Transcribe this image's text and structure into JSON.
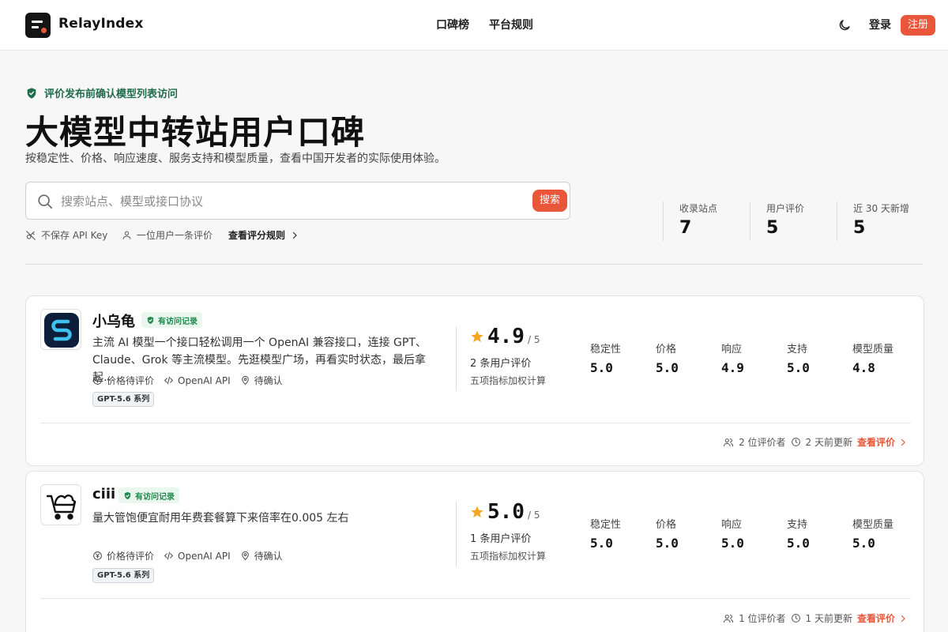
{
  "header": {
    "brand": "RelayIndex",
    "nav": [
      "口碑榜",
      "平台规则"
    ],
    "login": "登录",
    "register": "注册"
  },
  "hero": {
    "notice": "评价发布前确认模型列表访问",
    "title": "大模型中转站用户口碑",
    "subtitle": "按稳定性、价格、响应速度、服务支持和模型质量，查看中国开发者的实际使用体验。",
    "search": {
      "placeholder": "搜索站点、模型或接口协议",
      "button": "搜索"
    },
    "hints": [
      "不保存 API Key",
      "一位用户一条评价",
      "查看评分规则"
    ],
    "stats": [
      {
        "label": "收录站点",
        "value": "7"
      },
      {
        "label": "用户评价",
        "value": "5"
      },
      {
        "label": "近 30 天新增",
        "value": "5"
      }
    ]
  },
  "cards": [
    {
      "name": "小乌龟",
      "badge": "有访问记录",
      "desc": "主流 AI 模型一个接口轻松调用一个 OpenAI 兼容接口，连接 GPT、Claude、Grok 等主流模型。先逛模型广场，再看实时状态，最后拿起…",
      "meta": [
        "价格待评价",
        "OpenAI API",
        "待确认"
      ],
      "tag": "GPT-5.6 系列",
      "score": "4.9",
      "of": "/ 5",
      "reviews": "2 条用户评价",
      "weighted": "五项指标加权计算",
      "metrics": [
        {
          "label": "稳定性",
          "value": "5.0"
        },
        {
          "label": "价格",
          "value": "5.0"
        },
        {
          "label": "响应",
          "value": "4.9"
        },
        {
          "label": "支持",
          "value": "5.0"
        },
        {
          "label": "模型质量",
          "value": "4.8"
        }
      ],
      "reviewers": "2 位评价者",
      "updated": "2 天前更新",
      "link": "查看评价"
    },
    {
      "name": "ciii",
      "badge": "有访问记录",
      "desc": "量大管饱便宜耐用年费套餐算下来倍率在0.005 左右",
      "meta": [
        "价格待评价",
        "OpenAI API",
        "待确认"
      ],
      "tag": "GPT-5.6 系列",
      "score": "5.0",
      "of": "/ 5",
      "reviews": "1 条用户评价",
      "weighted": "五项指标加权计算",
      "metrics": [
        {
          "label": "稳定性",
          "value": "5.0"
        },
        {
          "label": "价格",
          "value": "5.0"
        },
        {
          "label": "响应",
          "value": "5.0"
        },
        {
          "label": "支持",
          "value": "5.0"
        },
        {
          "label": "模型质量",
          "value": "5.0"
        }
      ],
      "reviewers": "1 位评价者",
      "updated": "1 天前更新",
      "link": "查看评价"
    }
  ],
  "colors": {
    "accent": "#e9573a",
    "verified": "#1f8a4c",
    "star": "#f5a623"
  }
}
